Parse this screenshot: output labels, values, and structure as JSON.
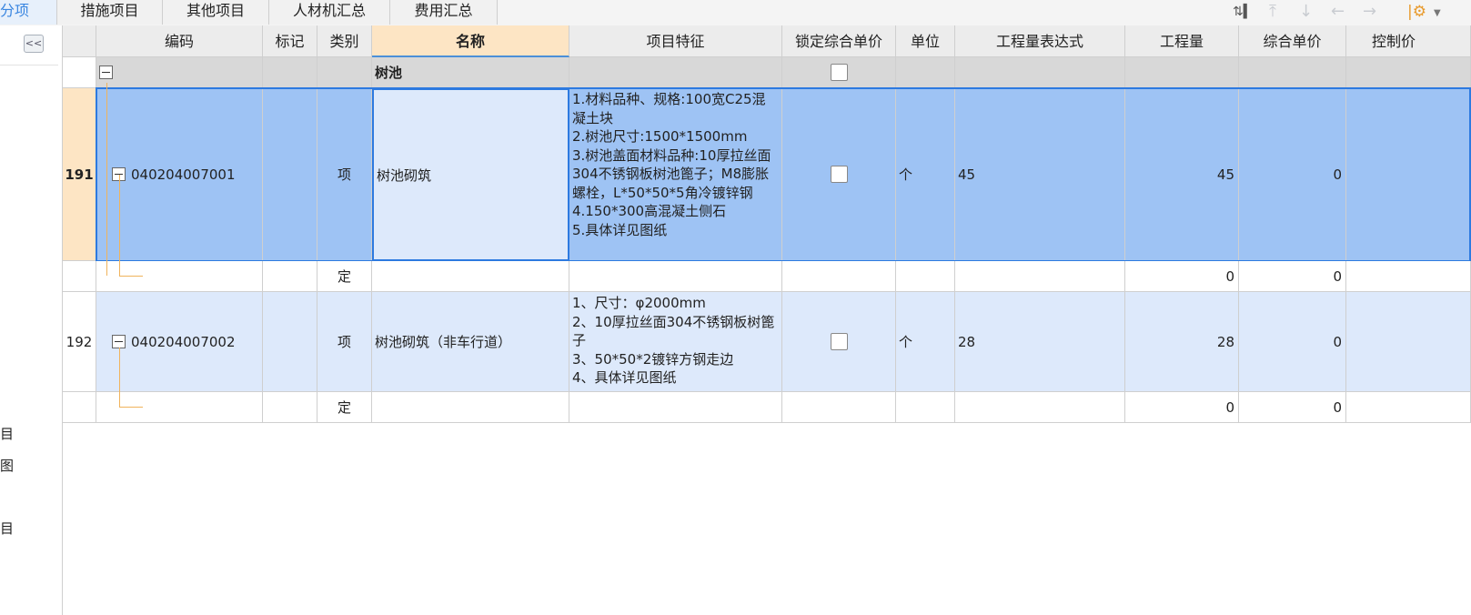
{
  "tabs": [
    {
      "label": "分部分项",
      "active": true
    },
    {
      "label": "措施项目"
    },
    {
      "label": "其他项目"
    },
    {
      "label": "人材机汇总"
    },
    {
      "label": "费用汇总"
    }
  ],
  "toolbar": {
    "icons": [
      "column-settings-icon",
      "move-up-top-icon",
      "move-down-icon",
      "move-left-icon",
      "move-right-icon",
      "settings-gear-icon",
      "dropdown-caret-icon"
    ]
  },
  "left_panel": {
    "collapse_label": "<<",
    "fragments": [
      "目",
      "图",
      "目"
    ]
  },
  "columns": [
    "编码",
    "标记",
    "类别",
    "名称",
    "项目特征",
    "锁定综合单价",
    "单位",
    "工程量表达式",
    "工程量",
    "综合单价",
    "控制价"
  ],
  "rows": [
    {
      "type": "group",
      "rownum": "",
      "code": "",
      "mark": "",
      "category": "",
      "name": "树池",
      "feature": "",
      "locked": false,
      "unit": "",
      "expr": "",
      "qty": "",
      "price": "",
      "ctrl": ""
    },
    {
      "type": "item",
      "rownum": "191",
      "code": "040204007001",
      "mark": "",
      "category": "项",
      "name": "树池砌筑",
      "feature": "1.材料品种、规格:100宽C25混凝土块\n2.树池尺寸:1500*1500mm\n3.树池盖面材料品种:10厚拉丝面304不锈钢板树池篦子；M8膨胀螺栓，L*50*50*5角冷镀锌钢\n4.150*300高混凝土侧石\n5.具体详见图纸",
      "locked": false,
      "unit": "个",
      "expr": "45",
      "qty": "45",
      "price": "0",
      "ctrl": ""
    },
    {
      "type": "sub",
      "rownum": "",
      "code": "",
      "mark": "",
      "category": "定",
      "name": "",
      "feature": "",
      "unit": "",
      "expr": "",
      "qty": "0",
      "price": "0",
      "ctrl": ""
    },
    {
      "type": "item",
      "rownum": "192",
      "code": "040204007002",
      "mark": "",
      "category": "项",
      "name": "树池砌筑（非车行道）",
      "feature": "1、尺寸：φ2000mm\n2、10厚拉丝面304不锈钢板树篦子\n3、50*50*2镀锌方钢走边\n4、具体详见图纸",
      "locked": false,
      "unit": "个",
      "expr": "28",
      "qty": "28",
      "price": "0",
      "ctrl": ""
    },
    {
      "type": "sub",
      "rownum": "",
      "code": "",
      "mark": "",
      "category": "定",
      "name": "",
      "feature": "",
      "unit": "",
      "expr": "",
      "qty": "0",
      "price": "0",
      "ctrl": ""
    }
  ]
}
